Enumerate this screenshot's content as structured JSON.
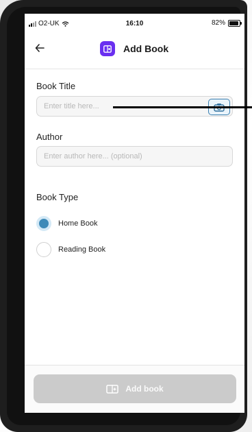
{
  "status_bar": {
    "carrier": "O2-UK",
    "time": "16:10",
    "battery": "82%"
  },
  "nav": {
    "back_icon": "arrow-left-icon",
    "title": "Add Book",
    "badge_icon": "add-book-icon",
    "accent_color": "#6a2ff0"
  },
  "form": {
    "title_label": "Book Title",
    "title_placeholder": "Enter title here...",
    "author_label": "Author",
    "author_placeholder": "Enter author here... (optional)",
    "camera_icon": "camera-icon",
    "book_type_label": "Book Type",
    "options": [
      {
        "label": "Home Book",
        "selected": true
      },
      {
        "label": "Reading Book",
        "selected": false
      }
    ],
    "radio_color": "#3e8ab8"
  },
  "footer": {
    "add_button_label": "Add book",
    "add_button_icon": "add-book-icon"
  }
}
